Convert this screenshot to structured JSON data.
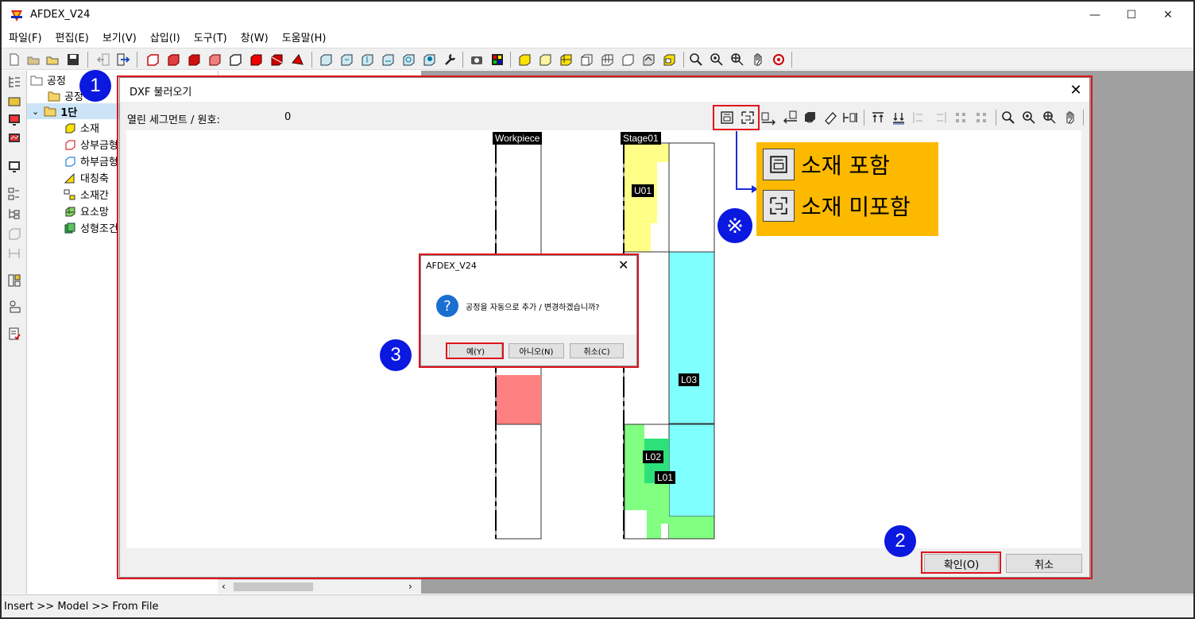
{
  "app": {
    "title": "AFDEX_V24"
  },
  "window_controls": {
    "minimize": "—",
    "maximize": "☐",
    "close": "✕"
  },
  "menu": [
    "파일(F)",
    "편집(E)",
    "보기(V)",
    "삽입(I)",
    "도구(T)",
    "창(W)",
    "도움말(H)"
  ],
  "tree": {
    "root": "공정",
    "child": "공정",
    "stage": "1단",
    "items": [
      "소재",
      "상부금형",
      "하부금형",
      "대칭축",
      "소재간",
      "요소망",
      "성형조건"
    ]
  },
  "status_bar": "Insert >> Model >> From File",
  "dxf_dialog": {
    "title": "DXF 불러오기",
    "segment_label": "열린 세그먼트 / 원호:",
    "segment_value": "0",
    "ok_label": "확인(O)",
    "cancel_label": "취소",
    "workpiece_label": "Workpiece",
    "stage_label": "Stage01",
    "part_labels": [
      "U01",
      "L03",
      "L02",
      "L01"
    ]
  },
  "message_box": {
    "title": "AFDEX_V24",
    "text": "공정을 자동으로 추가 / 변경하겠습니까?",
    "yes": "예(Y)",
    "no": "아니오(N)",
    "cancel": "취소(C)"
  },
  "callouts": [
    "1",
    "2",
    "3"
  ],
  "legend": {
    "mark": "※",
    "include": "소재 포함",
    "exclude": "소재 미포함"
  },
  "colors": {
    "highlight_red": "#e0141e",
    "callout_blue": "#0b18e0",
    "legend_bg": "#fcb900",
    "upper_die": "#ffff88",
    "lower_die_cyan": "#80ffff",
    "lower_die_green": "#80ff80",
    "workpiece_red": "#ff8080"
  }
}
